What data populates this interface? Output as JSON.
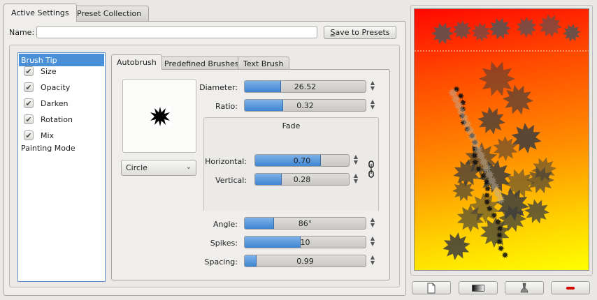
{
  "top_tabs": [
    {
      "label": "Active Settings",
      "active": true
    },
    {
      "label": "Preset Collection",
      "active": false
    }
  ],
  "name_field": {
    "label": "Name:",
    "value": ""
  },
  "save_button": {
    "label": "Save to Presets"
  },
  "options": [
    {
      "label": "Brush Tip",
      "checkbox": false,
      "selected": true
    },
    {
      "label": "Size",
      "checkbox": true,
      "checked": true
    },
    {
      "label": "Opacity",
      "checkbox": true,
      "checked": true
    },
    {
      "label": "Darken",
      "checkbox": true,
      "checked": true
    },
    {
      "label": "Rotation",
      "checkbox": true,
      "checked": true
    },
    {
      "label": "Mix",
      "checkbox": true,
      "checked": true
    },
    {
      "label": "Painting Mode",
      "checkbox": false
    }
  ],
  "brush_tabs": [
    {
      "label": "Autobrush",
      "active": true
    },
    {
      "label": "Predefined Brushes",
      "active": false
    },
    {
      "label": "Text Brush",
      "active": false
    }
  ],
  "shape_combo": {
    "value": "Circle"
  },
  "params": {
    "diameter": {
      "label": "Diameter:",
      "value": "26.52",
      "fraction": 0.3
    },
    "ratio": {
      "label": "Ratio:",
      "value": "0.32",
      "fraction": 0.32
    },
    "fade_title": "Fade",
    "horizontal": {
      "label": "Horizontal:",
      "value": "0.70",
      "fraction": 0.7
    },
    "vertical": {
      "label": "Vertical:",
      "value": "0.28",
      "fraction": 0.28
    },
    "angle": {
      "label": "Angle:",
      "value": "86°",
      "fraction": 0.24
    },
    "spikes": {
      "label": "Spikes:",
      "value": "10",
      "fraction": 0.46
    },
    "spacing": {
      "label": "Spacing:",
      "value": "0.99",
      "fraction": 0.1
    }
  },
  "colors": {
    "accent": "#4a90d9",
    "slider_fill": "#3d85d1",
    "delete_icon": "#d40000"
  },
  "bottom_buttons": [
    "new-document-icon",
    "gradient-icon",
    "paint-brush-icon",
    "delete-icon"
  ]
}
